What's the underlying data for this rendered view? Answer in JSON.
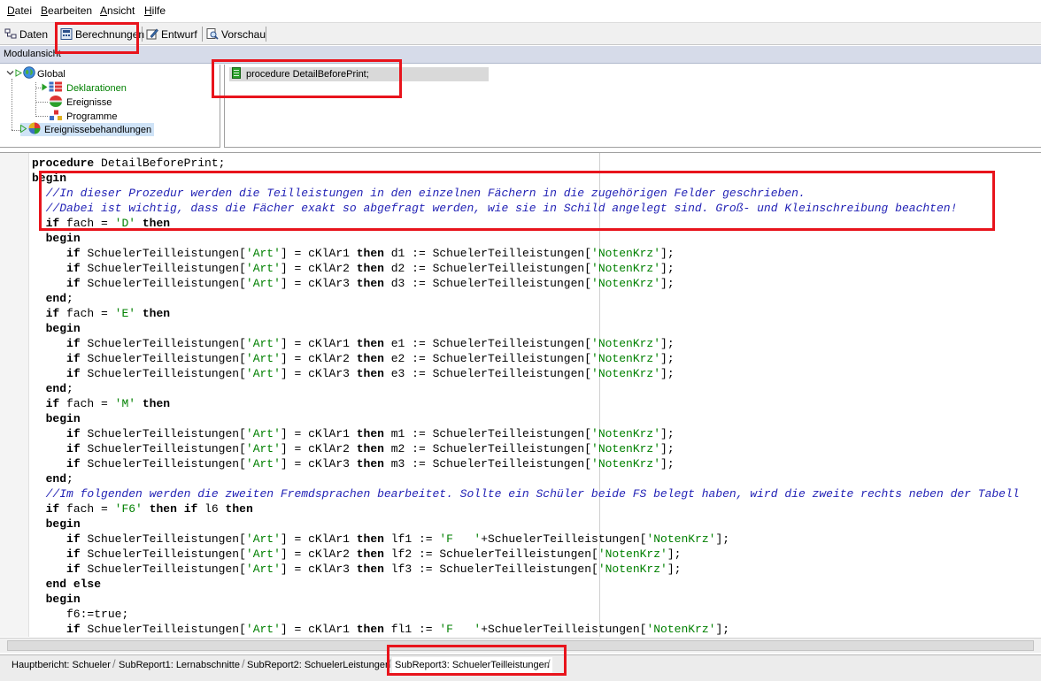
{
  "menu": [
    {
      "label": "Datei",
      "mnemonic": "D",
      "rest": "atei"
    },
    {
      "label": "Bearbeiten",
      "mnemonic": "B",
      "rest": "earbeiten"
    },
    {
      "label": "Ansicht",
      "mnemonic": "A",
      "rest": "nsicht"
    },
    {
      "label": "Hilfe",
      "mnemonic": "H",
      "rest": "ilfe"
    }
  ],
  "toolbar": {
    "daten_label": "Daten",
    "berechnungen_label": "Berechnungen",
    "entwurf_label": "Entwurf",
    "vorschau_label": "Vorschau"
  },
  "modul": {
    "title": "Modulansicht"
  },
  "tree": {
    "global": "Global",
    "deklarationen": "Deklarationen",
    "ereignisse": "Ereignisse",
    "programme": "Programme",
    "ereignisbehandlungen": "Ereignissebehandlungen"
  },
  "procedures": {
    "item": "procedure DetailBeforePrint;"
  },
  "code": {
    "lines": [
      [
        [
          "procedure DetailBeforePrint;",
          "kw-plain"
        ]
      ],
      [
        [
          "begin",
          "plain"
        ]
      ],
      [
        [
          "  //In dieser Prozedur werden die Teilleistungen in den einzelnen Fächern in die zugehörigen Felder geschrieben.",
          "cm"
        ]
      ],
      [
        [
          "  //Dabei ist wichtig, dass die Fächer exakt so abgefragt werden, wie sie in Schild angelegt sind. Groß- und Kleinschreibung beachten!",
          "cm"
        ]
      ],
      [
        [
          "  if fach = ",
          "plain"
        ],
        [
          "'D'",
          "str"
        ],
        [
          " then",
          "plain"
        ]
      ],
      [
        [
          "  begin",
          "plain"
        ]
      ],
      [
        [
          "     if SchuelerTeilleistungen[",
          "plain"
        ],
        [
          "'Art'",
          "str"
        ],
        [
          "] = cKlAr1 then d1 := SchuelerTeilleistungen[",
          "plain"
        ],
        [
          "'NotenKrz'",
          "str"
        ],
        [
          "];",
          "plain"
        ]
      ],
      [
        [
          "     if SchuelerTeilleistungen[",
          "plain"
        ],
        [
          "'Art'",
          "str"
        ],
        [
          "] = cKlAr2 then d2 := SchuelerTeilleistungen[",
          "plain"
        ],
        [
          "'NotenKrz'",
          "str"
        ],
        [
          "];",
          "plain"
        ]
      ],
      [
        [
          "     if SchuelerTeilleistungen[",
          "plain"
        ],
        [
          "'Art'",
          "str"
        ],
        [
          "] = cKlAr3 then d3 := SchuelerTeilleistungen[",
          "plain"
        ],
        [
          "'NotenKrz'",
          "str"
        ],
        [
          "];",
          "plain"
        ]
      ],
      [
        [
          "  end;",
          "plain"
        ]
      ],
      [
        [
          "  if fach = ",
          "plain"
        ],
        [
          "'E'",
          "str"
        ],
        [
          " then",
          "plain"
        ]
      ],
      [
        [
          "  begin",
          "plain"
        ]
      ],
      [
        [
          "     if SchuelerTeilleistungen[",
          "plain"
        ],
        [
          "'Art'",
          "str"
        ],
        [
          "] = cKlAr1 then e1 := SchuelerTeilleistungen[",
          "plain"
        ],
        [
          "'NotenKrz'",
          "str"
        ],
        [
          "];",
          "plain"
        ]
      ],
      [
        [
          "     if SchuelerTeilleistungen[",
          "plain"
        ],
        [
          "'Art'",
          "str"
        ],
        [
          "] = cKlAr2 then e2 := SchuelerTeilleistungen[",
          "plain"
        ],
        [
          "'NotenKrz'",
          "str"
        ],
        [
          "];",
          "plain"
        ]
      ],
      [
        [
          "     if SchuelerTeilleistungen[",
          "plain"
        ],
        [
          "'Art'",
          "str"
        ],
        [
          "] = cKlAr3 then e3 := SchuelerTeilleistungen[",
          "plain"
        ],
        [
          "'NotenKrz'",
          "str"
        ],
        [
          "];",
          "plain"
        ]
      ],
      [
        [
          "  end;",
          "plain"
        ]
      ],
      [
        [
          "  if fach = ",
          "plain"
        ],
        [
          "'M'",
          "str"
        ],
        [
          " then",
          "plain"
        ]
      ],
      [
        [
          "  begin",
          "plain"
        ]
      ],
      [
        [
          "     if SchuelerTeilleistungen[",
          "plain"
        ],
        [
          "'Art'",
          "str"
        ],
        [
          "] = cKlAr1 then m1 := SchuelerTeilleistungen[",
          "plain"
        ],
        [
          "'NotenKrz'",
          "str"
        ],
        [
          "];",
          "plain"
        ]
      ],
      [
        [
          "     if SchuelerTeilleistungen[",
          "plain"
        ],
        [
          "'Art'",
          "str"
        ],
        [
          "] = cKlAr2 then m2 := SchuelerTeilleistungen[",
          "plain"
        ],
        [
          "'NotenKrz'",
          "str"
        ],
        [
          "];",
          "plain"
        ]
      ],
      [
        [
          "     if SchuelerTeilleistungen[",
          "plain"
        ],
        [
          "'Art'",
          "str"
        ],
        [
          "] = cKlAr3 then m3 := SchuelerTeilleistungen[",
          "plain"
        ],
        [
          "'NotenKrz'",
          "str"
        ],
        [
          "];",
          "plain"
        ]
      ],
      [
        [
          "  end;",
          "plain"
        ]
      ],
      [
        [
          "  //Im folgenden werden die zweiten Fremdsprachen bearbeitet. Sollte ein Schüler beide FS belegt haben, wird die zweite rechts neben der Tabell",
          "cm"
        ]
      ],
      [
        [
          "  if fach = ",
          "plain"
        ],
        [
          "'F6'",
          "str"
        ],
        [
          " then if l6 then",
          "plain"
        ]
      ],
      [
        [
          "  begin",
          "plain"
        ]
      ],
      [
        [
          "     if SchuelerTeilleistungen[",
          "plain"
        ],
        [
          "'Art'",
          "str"
        ],
        [
          "] = cKlAr1 then lf1 := ",
          "plain"
        ],
        [
          "'F   '",
          "str"
        ],
        [
          "+SchuelerTeilleistungen[",
          "plain"
        ],
        [
          "'NotenKrz'",
          "str"
        ],
        [
          "];",
          "plain"
        ]
      ],
      [
        [
          "     if SchuelerTeilleistungen[",
          "plain"
        ],
        [
          "'Art'",
          "str"
        ],
        [
          "] = cKlAr2 then lf2 := SchuelerTeilleistungen[",
          "plain"
        ],
        [
          "'NotenKrz'",
          "str"
        ],
        [
          "];",
          "plain"
        ]
      ],
      [
        [
          "     if SchuelerTeilleistungen[",
          "plain"
        ],
        [
          "'Art'",
          "str"
        ],
        [
          "] = cKlAr3 then lf3 := SchuelerTeilleistungen[",
          "plain"
        ],
        [
          "'NotenKrz'",
          "str"
        ],
        [
          "];",
          "plain"
        ]
      ],
      [
        [
          "  end else",
          "plain"
        ]
      ],
      [
        [
          "  begin",
          "plain"
        ]
      ],
      [
        [
          "     f6:=true;",
          "plain"
        ]
      ],
      [
        [
          "     if SchuelerTeilleistungen[",
          "plain"
        ],
        [
          "'Art'",
          "str"
        ],
        [
          "] = cKlAr1 then fl1 := ",
          "plain"
        ],
        [
          "'F   '",
          "str"
        ],
        [
          "+SchuelerTeilleistungen[",
          "plain"
        ],
        [
          "'NotenKrz'",
          "str"
        ],
        [
          "];",
          "plain"
        ]
      ]
    ],
    "keywords": [
      "procedure",
      "begin",
      "end",
      "if",
      "then",
      "else"
    ]
  },
  "tabs": [
    {
      "label": "Hauptbericht: Schueler",
      "active": false
    },
    {
      "label": "SubReport1: Lernabschnitte",
      "active": false
    },
    {
      "label": "SubReport2: SchuelerLeistungen",
      "active": false
    },
    {
      "label": "SubReport3: SchuelerTeilleistungen",
      "active": true
    }
  ],
  "colors": {
    "highlight": "#e8141c",
    "comment": "#1f1fb4",
    "string": "#008000",
    "tree_selected": "#cfe3f7",
    "tree_green_text": "#008000"
  }
}
